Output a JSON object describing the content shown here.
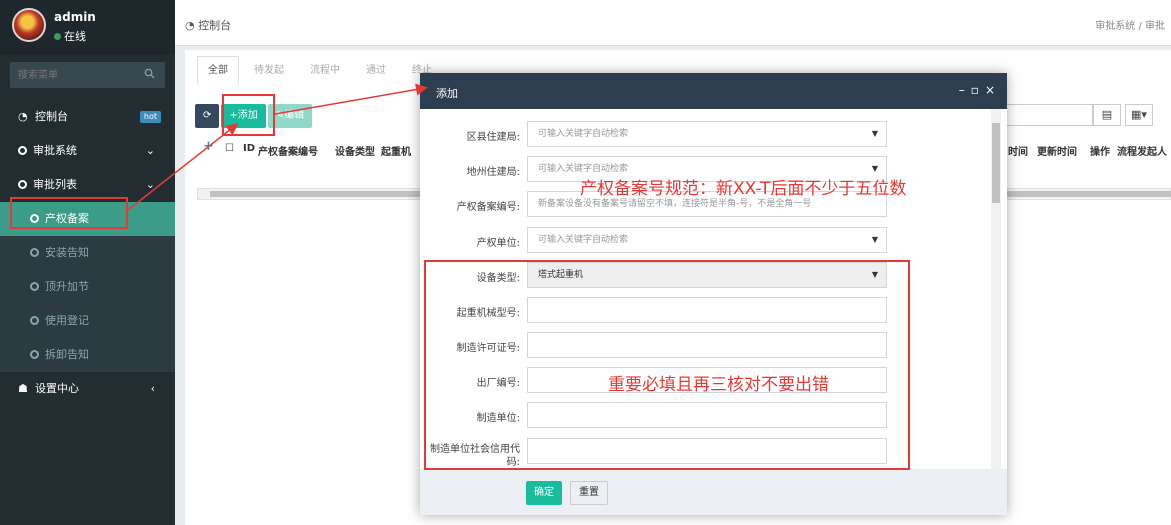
{
  "user": {
    "name": "admin",
    "status": "在线"
  },
  "sidebar": {
    "search_placeholder": "搜索菜单",
    "items": [
      {
        "label": "控制台",
        "badge": "hot"
      },
      {
        "label": "审批系统"
      },
      {
        "label": "审批列表"
      },
      {
        "label": "产权备案"
      },
      {
        "label": "安装告知"
      },
      {
        "label": "顶升加节"
      },
      {
        "label": "使用登记"
      },
      {
        "label": "拆卸告知"
      },
      {
        "label": "设置中心"
      }
    ]
  },
  "header": {
    "page_title": "控制台",
    "breadcrumb": "审批系统 / 审批"
  },
  "tabs": [
    "全部",
    "待发起",
    "流程中",
    "通过",
    "终止"
  ],
  "toolbar": {
    "add_label": "添加",
    "edit_label": "编辑"
  },
  "table": {
    "left_columns": [
      "ID",
      "产权备案编号",
      "设备类型",
      "起重机"
    ],
    "right_columns": [
      "时间",
      "更新时间",
      "操作",
      "流程发起人"
    ]
  },
  "modal": {
    "title": "添加",
    "fields": [
      {
        "label": "区县住建局:",
        "placeholder": "可输入关键字自动检索"
      },
      {
        "label": "地州住建局:",
        "placeholder": "可输入关键字自动检索"
      },
      {
        "label": "产权备案编号:",
        "placeholder": "新备案设备没有备案号请留空不填，连接符是半角-号，不是全角一号"
      },
      {
        "label": "产权单位:",
        "placeholder": "可输入关键字自动检索"
      },
      {
        "label": "设备类型:",
        "value": "塔式起重机"
      },
      {
        "label": "起重机械型号:",
        "value": ""
      },
      {
        "label": "制造许可证号:",
        "value": ""
      },
      {
        "label": "出厂编号:",
        "value": ""
      },
      {
        "label": "制造单位:",
        "value": ""
      },
      {
        "label": "制造单位社会信用代码:",
        "value": ""
      }
    ],
    "ok_label": "确定",
    "reset_label": "重置"
  },
  "annotations": {
    "note1": "产权备案号规范：新XX-T后面不少于五位数",
    "note2": "重要必填且再三核对不要出错"
  },
  "colors": {
    "sidebar_bg": "#222d32",
    "accent": "#18bc9c",
    "annotation": "#e53935",
    "modal_header": "#2c3e50"
  }
}
